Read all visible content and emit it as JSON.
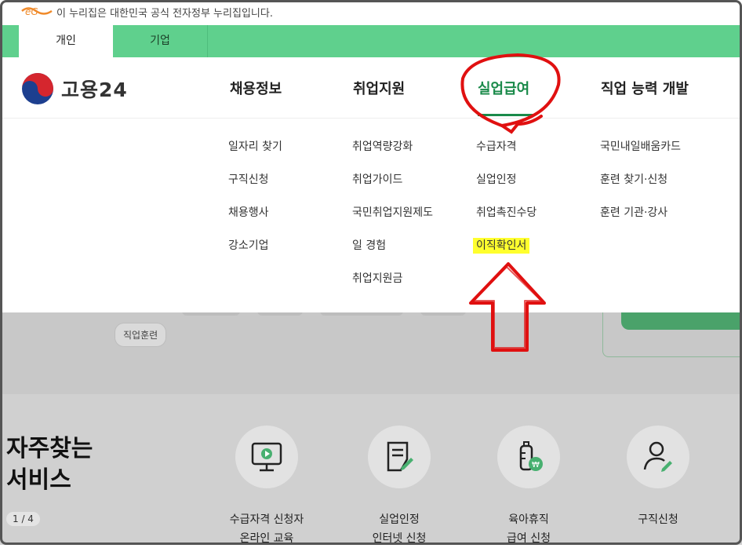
{
  "gov_banner": {
    "text": "이 누리집은 대한민국 공식 전자정부 누리집입니다."
  },
  "tabs": {
    "personal": "개인",
    "business": "기업"
  },
  "brand": {
    "name": "고용24"
  },
  "nav": [
    {
      "label": "채용정보"
    },
    {
      "label": "취업지원"
    },
    {
      "label": "실업급여"
    },
    {
      "label": "직업 능력 개발"
    }
  ],
  "menu": {
    "col1": [
      "일자리 찾기",
      "구직신청",
      "채용행사",
      "강소기업"
    ],
    "col2": [
      "취업역량강화",
      "취업가이드",
      "국민취업지원제도",
      "일 경험",
      "취업지원금"
    ],
    "col3": [
      "수급자격",
      "실업인정",
      "취업촉진수당",
      "이직확인서"
    ],
    "col4": [
      "국민내일배움카드",
      "훈련 찾기·신청",
      "훈련 기관·강사"
    ]
  },
  "chip": "직업훈련",
  "faq": {
    "title_line1": "자주찾는",
    "title_line2": "서비스",
    "pager": "1 / 4"
  },
  "services": [
    {
      "line1": "수급자격 신청자",
      "line2": "온라인 교육",
      "icon": "monitor-play-icon"
    },
    {
      "line1": "실업인정",
      "line2": "인터넷 신청",
      "icon": "document-pen-icon"
    },
    {
      "line1": "육아휴직",
      "line2": "급여 신청",
      "icon": "baby-bottle-icon"
    },
    {
      "line1": "구직신청",
      "line2": "",
      "icon": "person-pen-icon"
    }
  ],
  "colors": {
    "brand_green": "#5fd08d",
    "active_nav": "#1a8a4a",
    "highlight": "#ffff2e",
    "annotation_red": "#e01010"
  }
}
